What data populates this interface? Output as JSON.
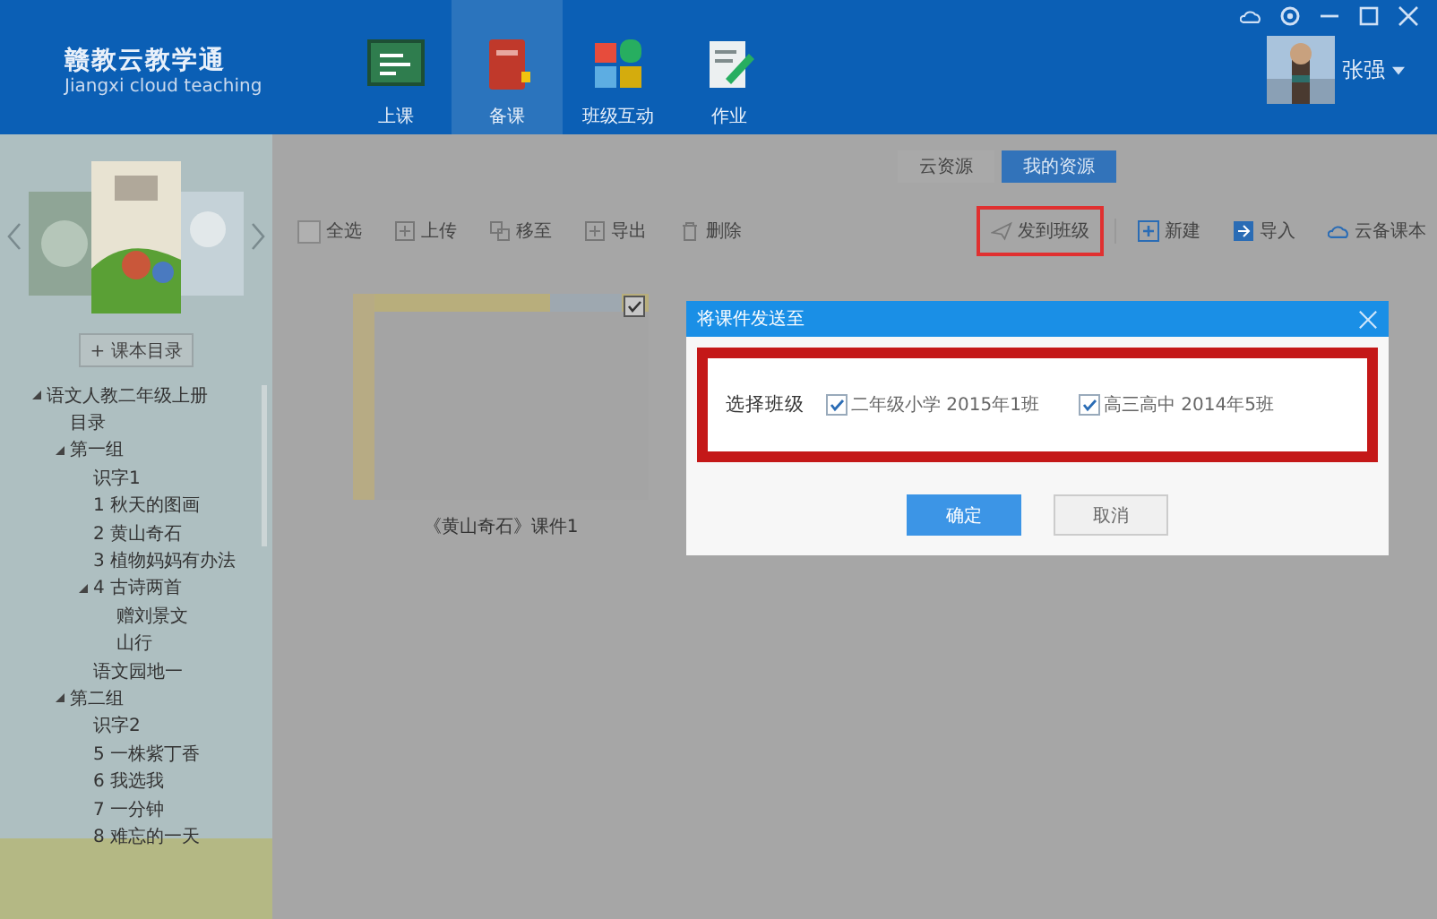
{
  "app": {
    "title": "赣教云教学通",
    "subtitle": "Jiangxi cloud teaching"
  },
  "nav": [
    {
      "label": "上课",
      "selected": false
    },
    {
      "label": "备课",
      "selected": true
    },
    {
      "label": "班级互动",
      "selected": false
    },
    {
      "label": "作业",
      "selected": false
    }
  ],
  "user": {
    "name": "张强"
  },
  "sidebar": {
    "catalog_button": "+ 课本目录",
    "tree": [
      {
        "label": "语文人教二年级上册",
        "expanded": true,
        "children": [
          {
            "label": "目录"
          },
          {
            "label": "第一组",
            "expanded": true,
            "children": [
              {
                "label": "识字1"
              },
              {
                "label": "1 秋天的图画"
              },
              {
                "label": "2 黄山奇石"
              },
              {
                "label": "3 植物妈妈有办法"
              },
              {
                "label": "4 古诗两首",
                "expanded": true,
                "children": [
                  {
                    "label": "赠刘景文"
                  },
                  {
                    "label": "山行"
                  }
                ]
              },
              {
                "label": "语文园地一"
              }
            ]
          },
          {
            "label": "第二组",
            "expanded": true,
            "children": [
              {
                "label": "识字2"
              },
              {
                "label": "5 一株紫丁香"
              },
              {
                "label": "6 我选我"
              },
              {
                "label": "7 一分钟"
              },
              {
                "label": "8 难忘的一天"
              }
            ]
          }
        ]
      }
    ]
  },
  "resource_tabs": [
    {
      "label": "云资源",
      "selected": false
    },
    {
      "label": "我的资源",
      "selected": true
    }
  ],
  "toolbar_left": [
    {
      "label": "全选",
      "kind": "checkbox",
      "checked": false
    },
    {
      "label": "上传",
      "kind": "upload"
    },
    {
      "label": "移至",
      "kind": "move"
    },
    {
      "label": "导出",
      "kind": "export"
    },
    {
      "label": "删除",
      "kind": "delete"
    }
  ],
  "send_button": {
    "label": "发到班级",
    "highlighted": true
  },
  "toolbar_right": [
    {
      "label": "新建",
      "kind": "new"
    },
    {
      "label": "导入",
      "kind": "import"
    },
    {
      "label": "云备课本",
      "kind": "cloud"
    }
  ],
  "files": [
    {
      "caption": "《黄山奇石》课件1",
      "checked": true
    }
  ],
  "dialog": {
    "title": "将课件发送至",
    "field_label": "选择班级",
    "highlighted": true,
    "classes": [
      {
        "label": "二年级小学 2015年1班",
        "checked": true
      },
      {
        "label": "高三高中 2014年5班",
        "checked": true
      }
    ],
    "buttons": [
      {
        "label": "确定",
        "kind": "primary"
      },
      {
        "label": "取消",
        "kind": "secondary"
      }
    ]
  }
}
